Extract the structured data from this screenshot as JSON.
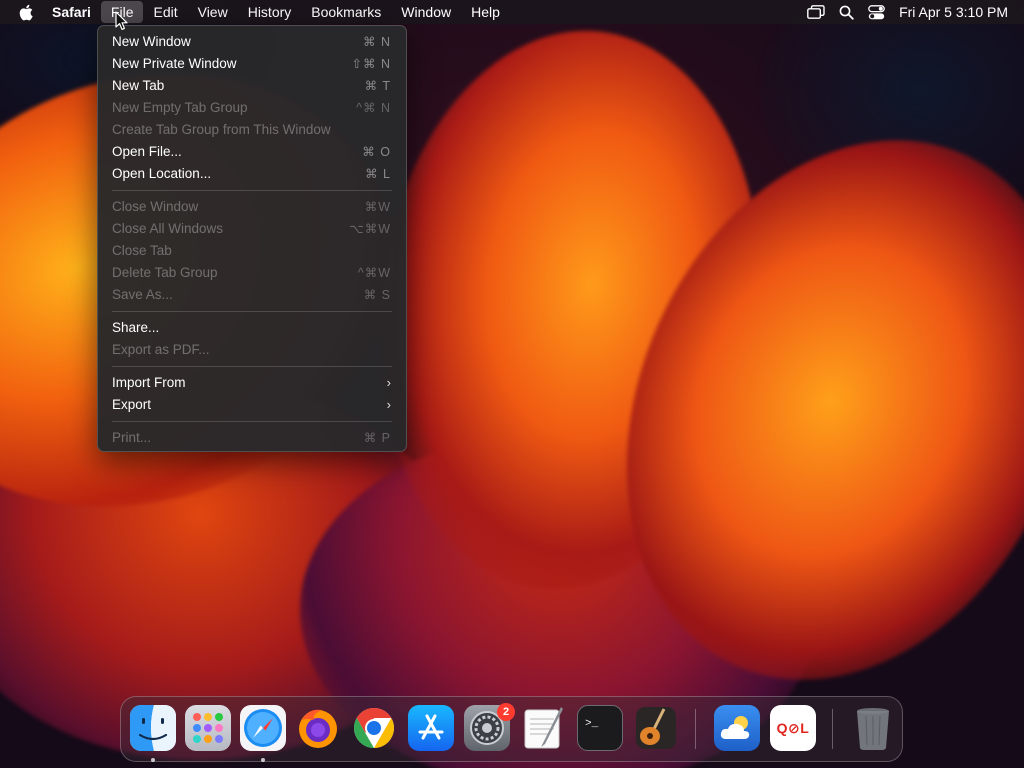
{
  "menubar": {
    "app_name": "Safari",
    "menus": [
      "File",
      "Edit",
      "View",
      "History",
      "Bookmarks",
      "Window",
      "Help"
    ],
    "active_menu": "File",
    "clock": "Fri Apr 5  3:10 PM",
    "icons": [
      "apple-logo-icon",
      "screen-mirroring-icon",
      "spotlight-search-icon",
      "control-center-icon"
    ]
  },
  "file_menu": {
    "groups": [
      [
        {
          "label": "New Window",
          "shortcut": "⌘ N",
          "enabled": true
        },
        {
          "label": "New Private Window",
          "shortcut": "⇧⌘ N",
          "enabled": true
        },
        {
          "label": "New Tab",
          "shortcut": "⌘ T",
          "enabled": true
        },
        {
          "label": "New Empty Tab Group",
          "shortcut": "^⌘ N",
          "enabled": false
        },
        {
          "label": "Create Tab Group from This Window",
          "shortcut": "",
          "enabled": false
        },
        {
          "label": "Open File...",
          "shortcut": "⌘ O",
          "enabled": true
        },
        {
          "label": "Open Location...",
          "shortcut": "⌘ L",
          "enabled": true
        }
      ],
      [
        {
          "label": "Close Window",
          "shortcut": "⌘W",
          "enabled": false
        },
        {
          "label": "Close All Windows",
          "shortcut": "⌥⌘W",
          "enabled": false
        },
        {
          "label": "Close Tab",
          "shortcut": "",
          "enabled": false
        },
        {
          "label": "Delete Tab Group",
          "shortcut": "^⌘W",
          "enabled": false
        },
        {
          "label": "Save As...",
          "shortcut": "⌘ S",
          "enabled": false
        }
      ],
      [
        {
          "label": "Share...",
          "shortcut": "",
          "enabled": true
        },
        {
          "label": "Export as PDF...",
          "shortcut": "",
          "enabled": false
        }
      ],
      [
        {
          "label": "Import From",
          "shortcut": "",
          "enabled": true,
          "submenu": true
        },
        {
          "label": "Export",
          "shortcut": "",
          "enabled": true,
          "submenu": true
        }
      ],
      [
        {
          "label": "Print...",
          "shortcut": "⌘ P",
          "enabled": false
        }
      ]
    ]
  },
  "dock": {
    "apps": [
      {
        "name": "Finder",
        "icon": "finder-icon",
        "running": true
      },
      {
        "name": "Launchpad",
        "icon": "launchpad-icon",
        "running": false
      },
      {
        "name": "Safari",
        "icon": "safari-icon",
        "running": true
      },
      {
        "name": "Firefox",
        "icon": "firefox-icon",
        "running": false
      },
      {
        "name": "Google Chrome",
        "icon": "chrome-icon",
        "running": false
      },
      {
        "name": "App Store",
        "icon": "app-store-icon",
        "running": false
      },
      {
        "name": "System Settings",
        "icon": "system-settings-icon",
        "running": false,
        "badge": "2"
      },
      {
        "name": "TextEdit",
        "icon": "textedit-icon",
        "running": false
      },
      {
        "name": "Terminal",
        "icon": "terminal-icon",
        "running": false
      },
      {
        "name": "GarageBand",
        "icon": "garageband-icon",
        "running": false
      },
      {
        "name": "Weather",
        "icon": "weather-icon",
        "running": false
      },
      {
        "name": "QOL",
        "icon": "qol-app-icon",
        "running": false,
        "label": "Q⊘L"
      },
      {
        "name": "Trash",
        "icon": "trash-icon",
        "running": false
      }
    ]
  }
}
